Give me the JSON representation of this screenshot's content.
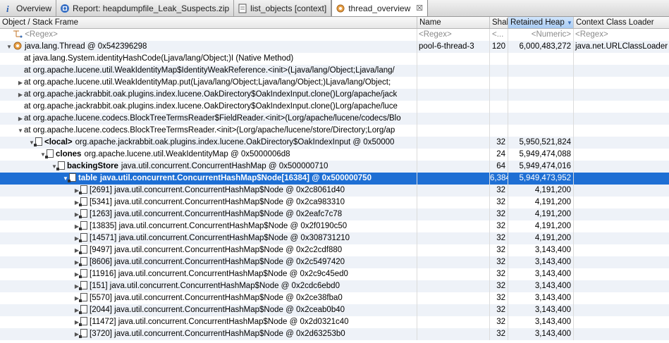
{
  "tabs": [
    {
      "label": "Overview",
      "icon": "info-icon"
    },
    {
      "label": "Report: heapdumpfile_Leak_Suspects.zip",
      "icon": "report-icon"
    },
    {
      "label": "list_objects [context]",
      "icon": "list-icon"
    },
    {
      "label": "thread_overview",
      "icon": "gears-icon",
      "close": "☒"
    }
  ],
  "columns": {
    "object": "Object / Stack Frame",
    "name": "Name",
    "shallow": "Shal",
    "retained": "Retained Heap",
    "loader": "Context Class Loader"
  },
  "filter": {
    "object": "<Regex>",
    "name": "<Regex>",
    "shallow": "<...",
    "retained": "<Numeric>",
    "loader": "<Regex>"
  },
  "rows": [
    {
      "indent": 0,
      "twisty": "▼",
      "icon": "thread",
      "text": "java.lang.Thread @ 0x542396298",
      "name": "pool-6-thread-3",
      "shallow": "120",
      "retained": "6,000,483,272",
      "loader": "java.net.URLClassLoader"
    },
    {
      "indent": 1,
      "twisty": "",
      "text": "at java.lang.System.identityHashCode(Ljava/lang/Object;)I (Native Method)"
    },
    {
      "indent": 1,
      "twisty": "",
      "text": "at org.apache.lucene.util.WeakIdentityMap$IdentityWeakReference.<init>(Ljava/lang/Object;Ljava/lang/"
    },
    {
      "indent": 1,
      "twisty": "▶",
      "text": "at org.apache.lucene.util.WeakIdentityMap.put(Ljava/lang/Object;Ljava/lang/Object;)Ljava/lang/Object;"
    },
    {
      "indent": 1,
      "twisty": "▶",
      "text": "at org.apache.jackrabbit.oak.plugins.index.lucene.OakDirectory$OakIndexInput.clone()Lorg/apache/jack"
    },
    {
      "indent": 1,
      "twisty": "",
      "text": "at org.apache.jackrabbit.oak.plugins.index.lucene.OakDirectory$OakIndexInput.clone()Lorg/apache/luce"
    },
    {
      "indent": 1,
      "twisty": "▶",
      "text": "at org.apache.lucene.codecs.BlockTreeTermsReader$FieldReader.<init>(Lorg/apache/lucene/codecs/Blo"
    },
    {
      "indent": 1,
      "twisty": "▼",
      "text": "at org.apache.lucene.codecs.BlockTreeTermsReader.<init>(Lorg/apache/lucene/store/Directory;Lorg/ap"
    },
    {
      "indent": 2,
      "twisty": "▼",
      "icon": "obj",
      "bold": "<local>",
      "text": "org.apache.jackrabbit.oak.plugins.index.lucene.OakDirectory$OakIndexInput @ 0x50000",
      "shallow": "32",
      "retained": "5,950,521,824"
    },
    {
      "indent": 3,
      "twisty": "▼",
      "icon": "obj",
      "bold": "clones",
      "text": "org.apache.lucene.util.WeakIdentityMap @ 0x5000006d8",
      "shallow": "24",
      "retained": "5,949,474,088"
    },
    {
      "indent": 4,
      "twisty": "▼",
      "icon": "obj",
      "bold": "backingStore",
      "text": "java.util.concurrent.ConcurrentHashMap @ 0x500000710",
      "shallow": "64",
      "retained": "5,949,474,016"
    },
    {
      "indent": 5,
      "twisty": "▼",
      "icon": "arr",
      "bold": "table",
      "text": "java.util.concurrent.ConcurrentHashMap$Node[16384] @ 0x500000750",
      "shallow": "6,384",
      "retained": "5,949,473,952",
      "selected": true
    },
    {
      "indent": 6,
      "twisty": "▶",
      "icon": "obj",
      "text": "[2691] java.util.concurrent.ConcurrentHashMap$Node @ 0x2c8061d40",
      "shallow": "32",
      "retained": "4,191,200"
    },
    {
      "indent": 6,
      "twisty": "▶",
      "icon": "obj",
      "text": "[5341] java.util.concurrent.ConcurrentHashMap$Node @ 0x2ca983310",
      "shallow": "32",
      "retained": "4,191,200"
    },
    {
      "indent": 6,
      "twisty": "▶",
      "icon": "obj",
      "text": "[1263] java.util.concurrent.ConcurrentHashMap$Node @ 0x2eafc7c78",
      "shallow": "32",
      "retained": "4,191,200"
    },
    {
      "indent": 6,
      "twisty": "▶",
      "icon": "obj",
      "text": "[13835] java.util.concurrent.ConcurrentHashMap$Node @ 0x2f0190c50",
      "shallow": "32",
      "retained": "4,191,200"
    },
    {
      "indent": 6,
      "twisty": "▶",
      "icon": "obj",
      "text": "[14571] java.util.concurrent.ConcurrentHashMap$Node @ 0x308731210",
      "shallow": "32",
      "retained": "4,191,200"
    },
    {
      "indent": 6,
      "twisty": "▶",
      "icon": "obj",
      "text": "[9497] java.util.concurrent.ConcurrentHashMap$Node @ 0x2c2cdf880",
      "shallow": "32",
      "retained": "3,143,400"
    },
    {
      "indent": 6,
      "twisty": "▶",
      "icon": "obj",
      "text": "[8606] java.util.concurrent.ConcurrentHashMap$Node @ 0x2c5497420",
      "shallow": "32",
      "retained": "3,143,400"
    },
    {
      "indent": 6,
      "twisty": "▶",
      "icon": "obj",
      "text": "[11916] java.util.concurrent.ConcurrentHashMap$Node @ 0x2c9c45ed0",
      "shallow": "32",
      "retained": "3,143,400"
    },
    {
      "indent": 6,
      "twisty": "▶",
      "icon": "obj",
      "text": "[151] java.util.concurrent.ConcurrentHashMap$Node @ 0x2cdc6ebd0",
      "shallow": "32",
      "retained": "3,143,400"
    },
    {
      "indent": 6,
      "twisty": "▶",
      "icon": "obj",
      "text": "[5570] java.util.concurrent.ConcurrentHashMap$Node @ 0x2ce38fba0",
      "shallow": "32",
      "retained": "3,143,400"
    },
    {
      "indent": 6,
      "twisty": "▶",
      "icon": "obj",
      "text": "[2044] java.util.concurrent.ConcurrentHashMap$Node @ 0x2ceab0b40",
      "shallow": "32",
      "retained": "3,143,400"
    },
    {
      "indent": 6,
      "twisty": "▶",
      "icon": "obj",
      "text": "[11472] java.util.concurrent.ConcurrentHashMap$Node @ 0x2d0321c40",
      "shallow": "32",
      "retained": "3,143,400"
    },
    {
      "indent": 6,
      "twisty": "▶",
      "icon": "obj",
      "text": "[3720] java.util.concurrent.ConcurrentHashMap$Node @ 0x2d63253b0",
      "shallow": "32",
      "retained": "3,143,400"
    }
  ]
}
